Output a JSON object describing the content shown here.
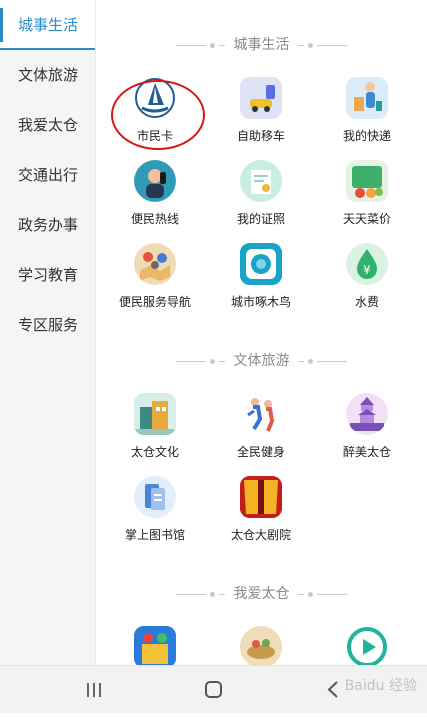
{
  "sidebar": {
    "items": [
      {
        "label": "城事生活",
        "active": true
      },
      {
        "label": "文体旅游",
        "active": false
      },
      {
        "label": "我爱太仓",
        "active": false
      },
      {
        "label": "交通出行",
        "active": false
      },
      {
        "label": "政务办事",
        "active": false
      },
      {
        "label": "学习教育",
        "active": false
      },
      {
        "label": "专区服务",
        "active": false
      }
    ]
  },
  "sections": [
    {
      "title": "城事生活",
      "tiles": [
        {
          "label": "市民卡",
          "icon": "sail-logo-icon"
        },
        {
          "label": "自助移车",
          "icon": "car-move-icon"
        },
        {
          "label": "我的快递",
          "icon": "delivery-icon"
        },
        {
          "label": "便民热线",
          "icon": "hotline-icon"
        },
        {
          "label": "我的证照",
          "icon": "certificate-icon"
        },
        {
          "label": "天天菜价",
          "icon": "vegetable-price-icon"
        },
        {
          "label": "便民服务导航",
          "icon": "map-pin-icon"
        },
        {
          "label": "城市啄木鸟",
          "icon": "camera-lens-icon"
        },
        {
          "label": "水费",
          "icon": "water-drop-yuan-icon"
        }
      ]
    },
    {
      "title": "文体旅游",
      "tiles": [
        {
          "label": "太仓文化",
          "icon": "culture-building-icon"
        },
        {
          "label": "全民健身",
          "icon": "fitness-runner-icon"
        },
        {
          "label": "醉美太仓",
          "icon": "pagoda-icon"
        },
        {
          "label": "掌上图书馆",
          "icon": "library-book-icon"
        },
        {
          "label": "太仓大剧院",
          "icon": "theater-curtain-icon"
        }
      ]
    },
    {
      "title": "我爱太仓",
      "tiles": [
        {
          "label": "",
          "icon": "shopping-icon"
        },
        {
          "label": "",
          "icon": "food-icon"
        },
        {
          "label": "",
          "icon": "play-circle-icon"
        }
      ]
    }
  ],
  "navbar": {
    "recent": "|||",
    "home": "○",
    "back": "<"
  },
  "watermark": "Baidu 经验",
  "colors": {
    "accent": "#2a8cc8",
    "highlight_ring": "#d41818"
  }
}
